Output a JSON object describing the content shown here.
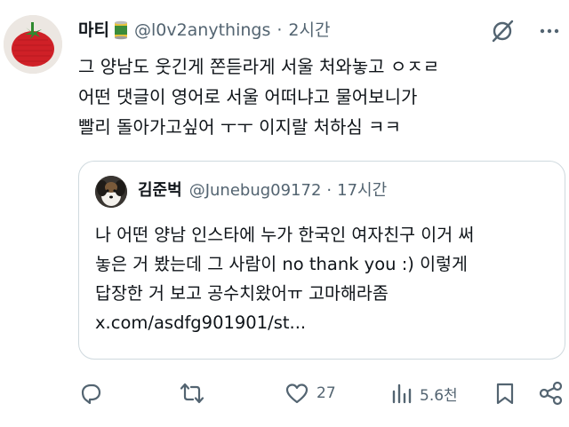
{
  "tweet": {
    "author_name": "마티",
    "handle": "@l0v2anythings",
    "separator": "·",
    "time": "2시간",
    "text": "그 양남도 웃긴게 쫀듣라게 서울 처와놓고 ㅇㅈㄹ\n어떤 댓글이 영어로 서울 어떠냐고 물어보니가\n빨리 돌아가고싶어 ㅜㅜ 이지랄 처하심 ㅋㅋ",
    "avatar_icon": "crochet-tomato-avatar",
    "badge_icon": "can-emoji"
  },
  "quote": {
    "author_name": "김준벅",
    "handle": "@Junebug09172",
    "separator": "·",
    "time": "17시간",
    "text": "나 어떤 양남 인스타에 누가 한국인 여자친구 이거 써\n놓은 거 봤는데 그 사람이 no thank you :) 이렇게\n답장한 거 보고 공수치왔어ㅠ 고마해라좀\nx.com/asdfg901901/st...",
    "avatar_icon": "dog-avatar"
  },
  "actions": {
    "reply_count": "",
    "retweet_count": "",
    "like_count": "27",
    "view_count": "5.6천"
  },
  "colors": {
    "text": "#0f1419",
    "secondary": "#536471",
    "border": "#cfd9de"
  }
}
